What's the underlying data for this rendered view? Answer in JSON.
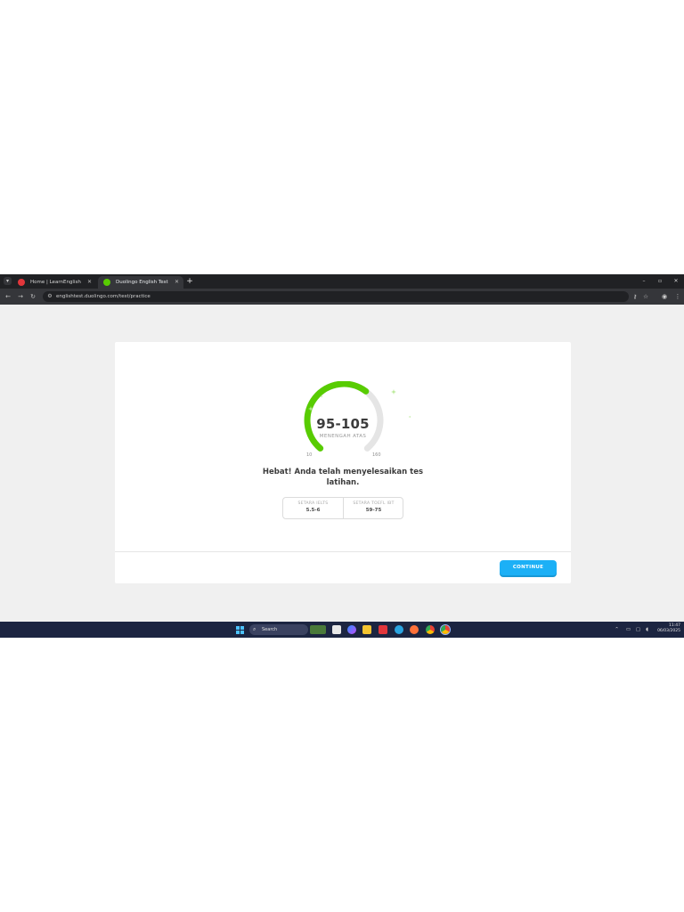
{
  "browser": {
    "tabs": [
      {
        "label": "Home | LearnEnglish",
        "active": false
      },
      {
        "label": "Duolingo English Test",
        "active": true
      }
    ],
    "new_tab_symbol": "+",
    "url": "englishtest.duolingo.com/test/practice",
    "window_controls": [
      "–",
      "▫",
      "✕"
    ]
  },
  "result": {
    "score_range": "95-105",
    "score_caption": "MENENGAH ATAS",
    "scale_min": "10",
    "scale_max": "160",
    "score_fraction_low": 0.567,
    "score_fraction_high": 0.633,
    "message": "Hebat! Anda telah menyelesaikan tes latihan.",
    "equivalents": [
      {
        "label": "SETARA IELTS",
        "value": "5.5-6"
      },
      {
        "label": "SETARA TOEFL IBT",
        "value": "59-75"
      }
    ],
    "continue_label": "CONTINUE"
  },
  "colors": {
    "gauge_fill": "#58cc02",
    "gauge_track": "#e5e5e5",
    "sparkle": "#b8e994",
    "button": "#1cb0f6"
  },
  "taskbar": {
    "search_placeholder": "Search",
    "time": "11:47",
    "date": "06/03/2025",
    "apps": [
      "start-icon",
      "search-icon",
      "widgets-icon",
      "file-explorer-icon",
      "copilot-icon",
      "folder-icon",
      "store-icon",
      "edge-icon",
      "firefox-icon",
      "chrome-icon",
      "chrome-alt-icon"
    ]
  }
}
